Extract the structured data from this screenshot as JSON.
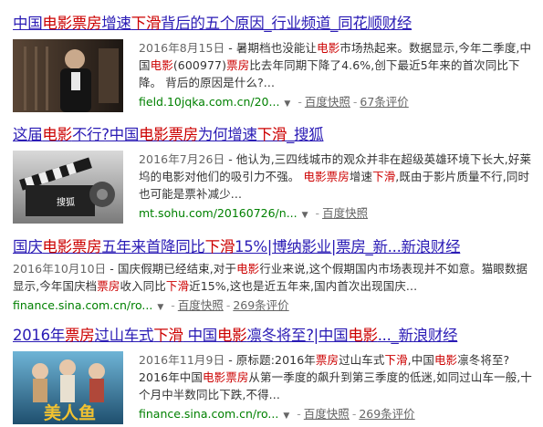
{
  "results": [
    {
      "title": [
        {
          "t": "中国",
          "em": false
        },
        {
          "t": "电影票房",
          "em": true
        },
        {
          "t": "增速",
          "em": false
        },
        {
          "t": "下滑",
          "em": true
        },
        {
          "t": "背后的五个原因_行业频道_同花顺财经",
          "em": false
        }
      ],
      "date": "2016年8月15日",
      "abstract": [
        {
          "t": " - 暑期档也没能让",
          "em": false
        },
        {
          "t": "电影",
          "em": true
        },
        {
          "t": "市场热起来。数据显示,今年二季度,中国",
          "em": false
        },
        {
          "t": "电影",
          "em": true
        },
        {
          "t": "(600977)",
          "em": false
        },
        {
          "t": "票房",
          "em": true
        },
        {
          "t": "比去年同期下降了4.6%,创下最近5年来的首次同比下降。 背后的原因是什么?...",
          "em": false
        }
      ],
      "url": "field.10jqka.com.cn/20...",
      "snapshot": "百度快照",
      "comments": "67条评价"
    },
    {
      "title": [
        {
          "t": "这届",
          "em": false
        },
        {
          "t": "电影",
          "em": true
        },
        {
          "t": "不行?中国",
          "em": false
        },
        {
          "t": "电影票房",
          "em": true
        },
        {
          "t": "为何增速",
          "em": false
        },
        {
          "t": "下滑",
          "em": true
        },
        {
          "t": "_搜狐",
          "em": false
        }
      ],
      "date": "2016年7月26日",
      "abstract": [
        {
          "t": " - 他认为,三四线城市的观众并非在超级英雄环境下长大,好莱坞的电影对他们的吸引力不强。 ",
          "em": false
        },
        {
          "t": "电影票房",
          "em": true
        },
        {
          "t": "增速",
          "em": false
        },
        {
          "t": "下滑",
          "em": true
        },
        {
          "t": ",既由于影片质量不行,同时也可能是票补减少...",
          "em": false
        }
      ],
      "url": "mt.sohu.com/20160726/n...",
      "snapshot": "百度快照",
      "comments": ""
    },
    {
      "title": [
        {
          "t": "国庆",
          "em": false
        },
        {
          "t": "电影票房",
          "em": true
        },
        {
          "t": "五年来首降同比",
          "em": false
        },
        {
          "t": "下滑",
          "em": true
        },
        {
          "t": "15%|博纳影业|票房_新...新浪财经",
          "em": false
        }
      ],
      "date": "2016年10月10日",
      "abstract": [
        {
          "t": " - 国庆假期已经结束,对于",
          "em": false
        },
        {
          "t": "电影",
          "em": true
        },
        {
          "t": "行业来说,这个假期国内市场表现并不如意。猫眼数据显示,今年国庆档",
          "em": false
        },
        {
          "t": "票房",
          "em": true
        },
        {
          "t": "收入同比",
          "em": false
        },
        {
          "t": "下滑",
          "em": true
        },
        {
          "t": "近15%,这也是近五年来,国内首次出现国庆...",
          "em": false
        }
      ],
      "url": "finance.sina.com.cn/ro...",
      "snapshot": "百度快照",
      "comments": "269条评价"
    },
    {
      "title": [
        {
          "t": "2016年",
          "em": false
        },
        {
          "t": "票房",
          "em": true
        },
        {
          "t": "过山车式",
          "em": false
        },
        {
          "t": "下滑",
          "em": true
        },
        {
          "t": " 中国",
          "em": false
        },
        {
          "t": "电影",
          "em": true
        },
        {
          "t": "凛冬将至?|中国",
          "em": false
        },
        {
          "t": "电影",
          "em": true
        },
        {
          "t": "..._新浪财经",
          "em": false
        }
      ],
      "date": "2016年11月9日",
      "abstract": [
        {
          "t": " - 原标题:2016年",
          "em": false
        },
        {
          "t": "票房",
          "em": true
        },
        {
          "t": "过山车式",
          "em": false
        },
        {
          "t": "下滑",
          "em": true
        },
        {
          "t": ",中国",
          "em": false
        },
        {
          "t": "电影",
          "em": true
        },
        {
          "t": "凛冬将至? 2016年中国",
          "em": false
        },
        {
          "t": "电影票房",
          "em": true
        },
        {
          "t": "从第一季度的飙升到第三季度的低迷,如同过山车一般,十个月中半数同比下跌,不得...",
          "em": false
        }
      ],
      "url": "finance.sina.com.cn/ro...",
      "snapshot": "百度快照",
      "comments": "269条评价"
    }
  ],
  "thumb_text": {
    "r2_watermark": "搜狐",
    "r4_poster": "美人鱼"
  }
}
